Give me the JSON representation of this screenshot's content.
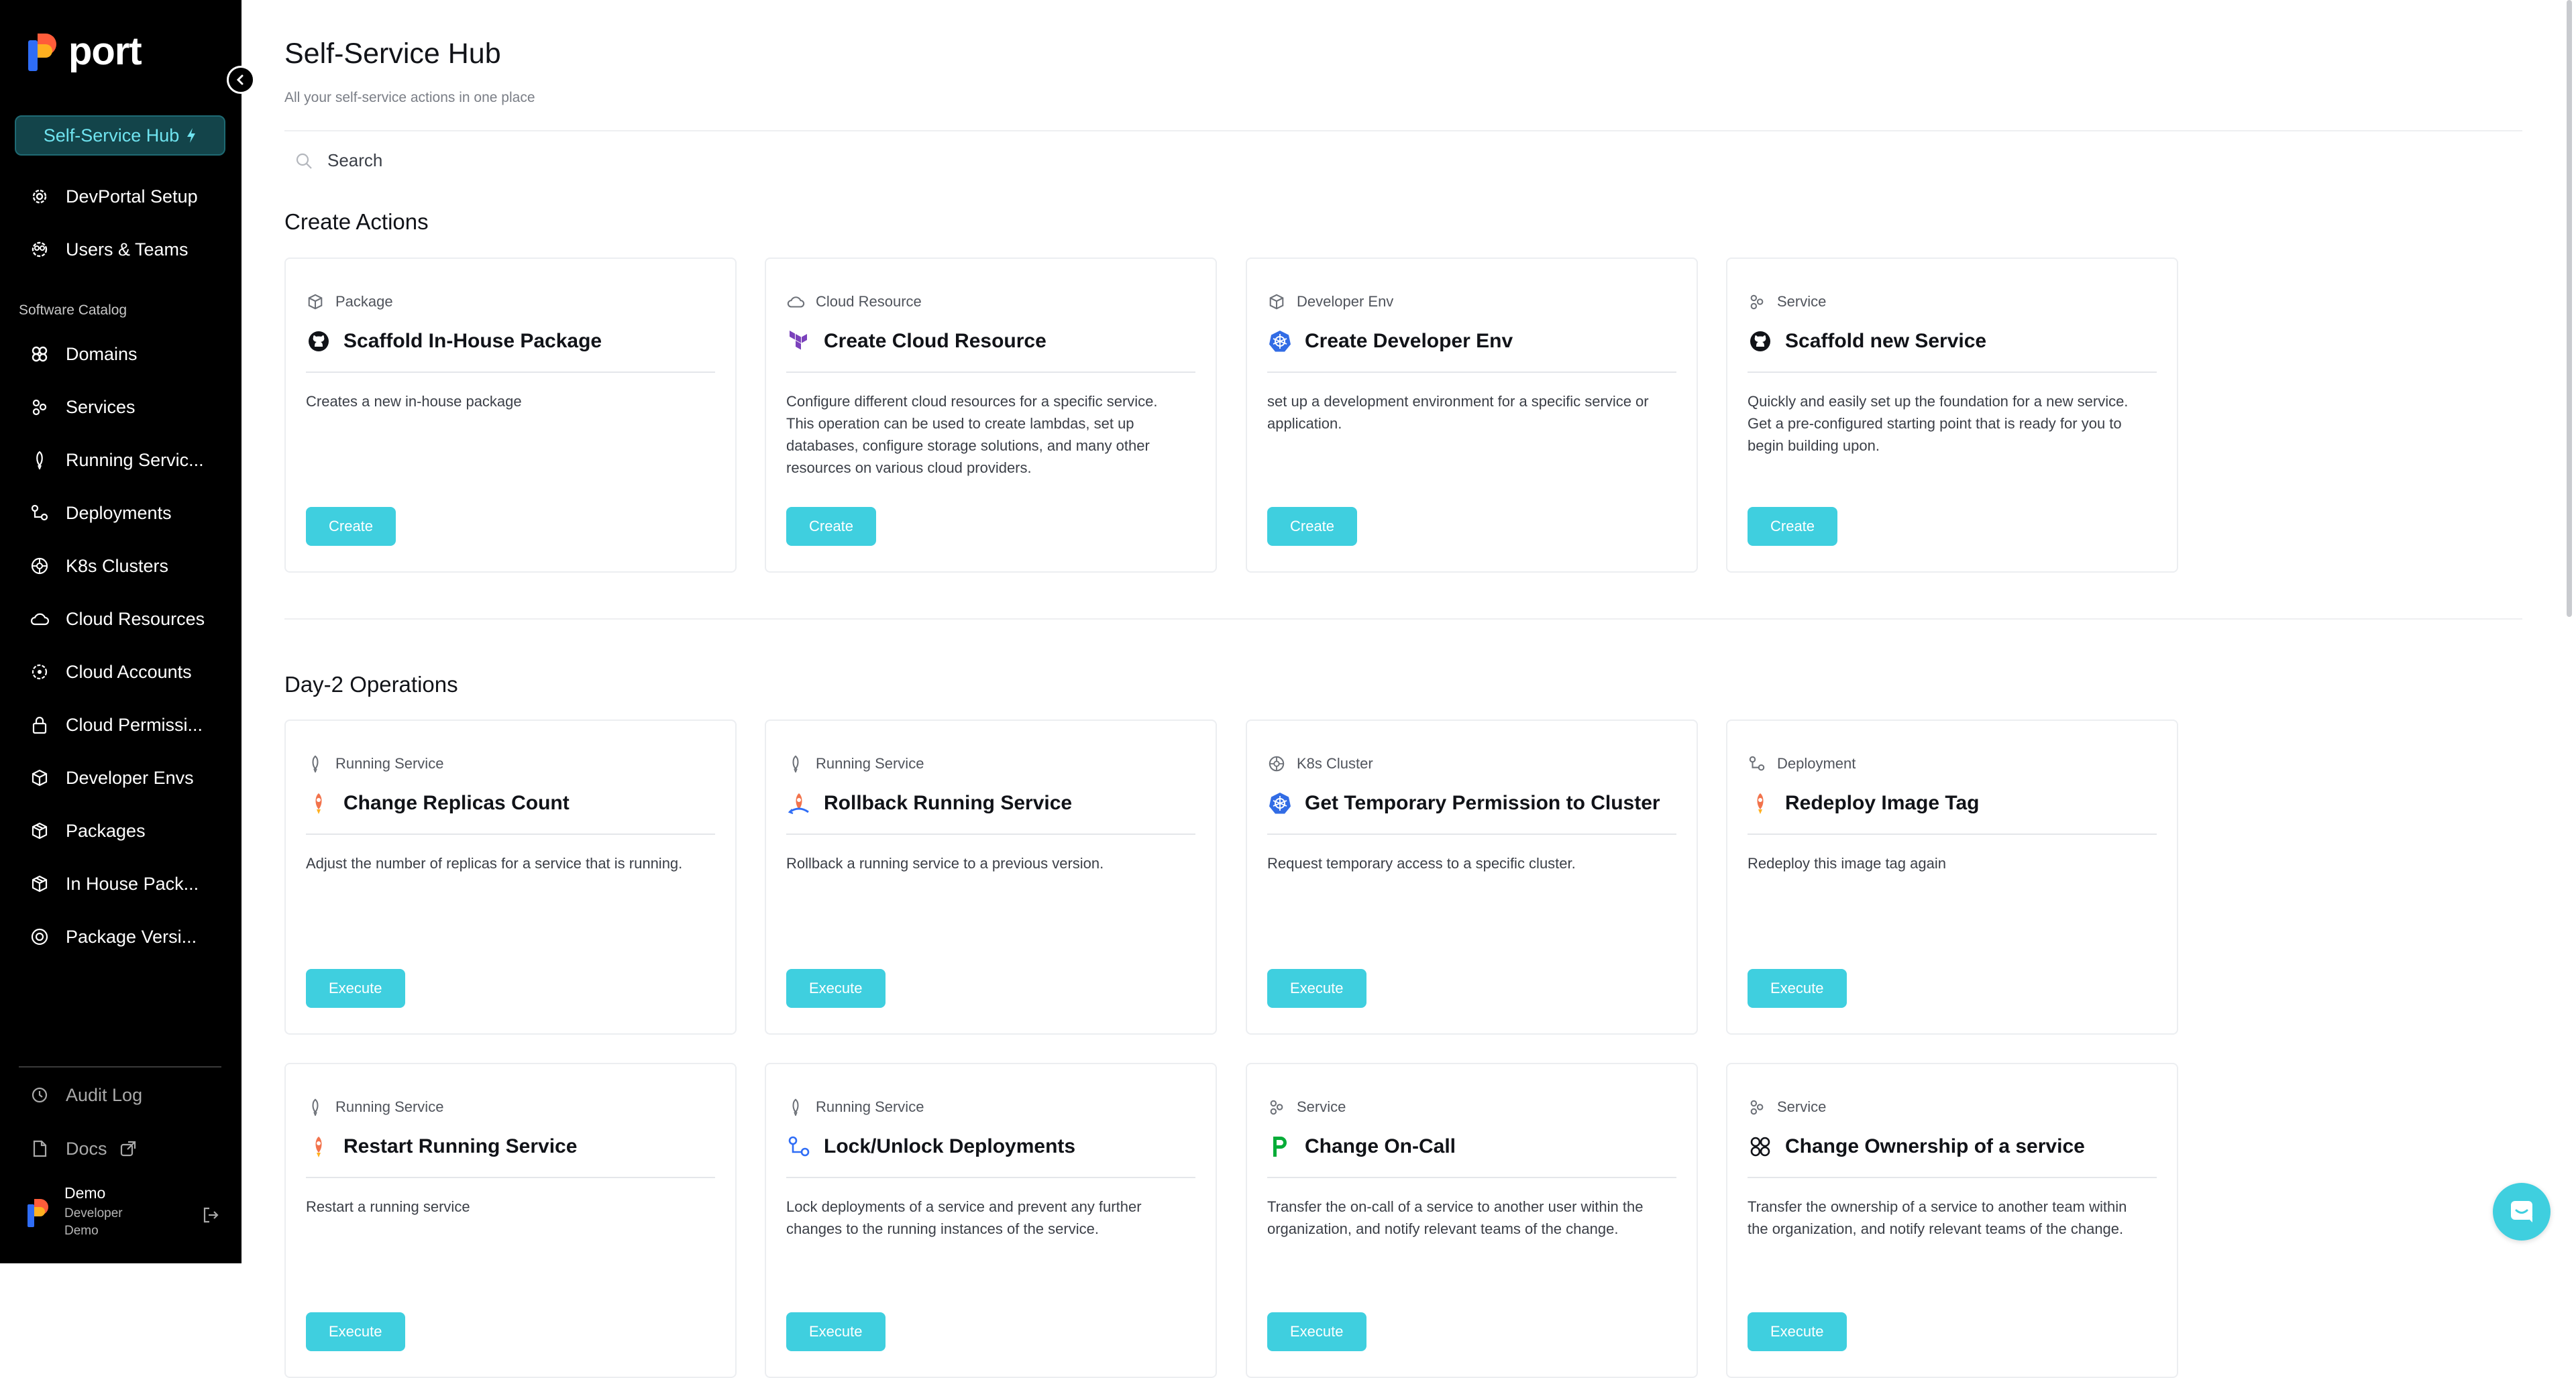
{
  "app": {
    "logo_text": "port"
  },
  "sidebar": {
    "active": {
      "label": "Self-Service Hub"
    },
    "top_items": [
      {
        "label": "DevPortal Setup",
        "icon": "gear-icon"
      },
      {
        "label": "Users & Teams",
        "icon": "users-gear-icon"
      }
    ],
    "section_label": "Software Catalog",
    "catalog_items": [
      {
        "label": "Domains",
        "icon": "domains-icon"
      },
      {
        "label": "Services",
        "icon": "services-icon"
      },
      {
        "label": "Running Servic...",
        "icon": "rocket-icon"
      },
      {
        "label": "Deployments",
        "icon": "deployments-icon"
      },
      {
        "label": "K8s Clusters",
        "icon": "helm-icon"
      },
      {
        "label": "Cloud Resources",
        "icon": "cloud-icon"
      },
      {
        "label": "Cloud Accounts",
        "icon": "cloud-account-icon"
      },
      {
        "label": "Cloud Permissi...",
        "icon": "lock-icon"
      },
      {
        "label": "Developer Envs",
        "icon": "cube-icon"
      },
      {
        "label": "Packages",
        "icon": "package-icon"
      },
      {
        "label": "In House Pack...",
        "icon": "package-icon"
      },
      {
        "label": "Package Versi...",
        "icon": "versions-icon"
      }
    ],
    "bottom_items": [
      {
        "label": "Audit Log",
        "icon": "history-icon"
      },
      {
        "label": "Docs",
        "icon": "docs-icon"
      }
    ],
    "user": {
      "name": "Demo",
      "role": "Developer",
      "org": "Demo"
    }
  },
  "page": {
    "title": "Self-Service Hub",
    "subtitle": "All your self-service actions in one place",
    "search_placeholder": "Search"
  },
  "sections": [
    {
      "title": "Create Actions",
      "cards": [
        {
          "blueprint": "Package",
          "title": "Scaffold In-House Package",
          "description": "Creates a new in-house package",
          "button": "Create"
        },
        {
          "blueprint": "Cloud Resource",
          "title": "Create Cloud Resource",
          "description": "Configure different cloud resources for a specific service. This operation can be used to create lambdas, set up databases, configure storage solutions, and many other resources on various cloud providers.",
          "button": "Create"
        },
        {
          "blueprint": "Developer Env",
          "title": "Create Developer Env",
          "description": "set up a development environment for a specific service or application.",
          "button": "Create"
        },
        {
          "blueprint": "Service",
          "title": "Scaffold new Service",
          "description": "Quickly and easily set up the foundation for a new service. Get a pre-configured starting point that is ready for you to begin building upon.",
          "button": "Create"
        }
      ]
    },
    {
      "title": "Day-2 Operations",
      "cards": [
        {
          "blueprint": "Running Service",
          "title": "Change Replicas Count",
          "description": "Adjust the number of replicas for a service that is running.",
          "button": "Execute"
        },
        {
          "blueprint": "Running Service",
          "title": "Rollback Running Service",
          "description": "Rollback a running service to a previous version.",
          "button": "Execute"
        },
        {
          "blueprint": "K8s Cluster",
          "title": "Get Temporary Permission to Cluster",
          "description": "Request temporary access to a specific cluster.",
          "button": "Execute"
        },
        {
          "blueprint": "Deployment",
          "title": "Redeploy Image Tag",
          "description": "Redeploy this image tag again",
          "button": "Execute"
        },
        {
          "blueprint": "Running Service",
          "title": "Restart Running Service",
          "description": "Restart a running service",
          "button": "Execute"
        },
        {
          "blueprint": "Running Service",
          "title": "Lock/Unlock Deployments",
          "description": "Lock deployments of a service and prevent any further changes to the running instances of the service.",
          "button": "Execute"
        },
        {
          "blueprint": "Service",
          "title": "Change On-Call",
          "description": "Transfer the on-call of a service to another user within the organization, and notify relevant teams of the change.",
          "button": "Execute"
        },
        {
          "blueprint": "Service",
          "title": "Change Ownership of a service",
          "description": "Transfer the ownership of a service to another team within the organization, and notify relevant teams of the change.",
          "button": "Execute"
        }
      ]
    }
  ],
  "colors": {
    "accent": "#3fcfdf",
    "sidebar_bg": "#000000",
    "hub_text": "#6fe3ef"
  }
}
